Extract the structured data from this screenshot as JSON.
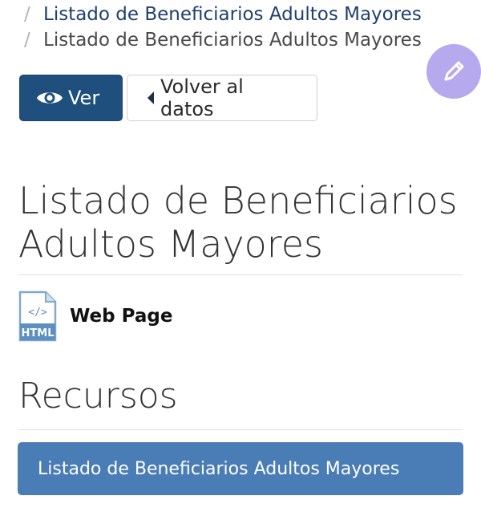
{
  "breadcrumb": {
    "separator": "/",
    "items": [
      {
        "label": "Listado de Beneficiarios Adultos Mayores"
      },
      {
        "label": "Listado de Beneficiarios Adultos Mayores"
      }
    ]
  },
  "actions": {
    "view_label": "Ver",
    "back_label": "Volver al datos"
  },
  "title": "Listado de Beneficiarios Adultos Mayores",
  "format": {
    "icon_text": "HTML",
    "label": "Web Page"
  },
  "resources": {
    "heading": "Recursos",
    "items": [
      {
        "label": "Listado de Beneficiarios Adultos Mayores"
      }
    ]
  },
  "colors": {
    "primary": "#1f4f7c",
    "resource": "#4a7cb5",
    "fab": "#b7a9ee",
    "link": "#1f3f6e"
  }
}
